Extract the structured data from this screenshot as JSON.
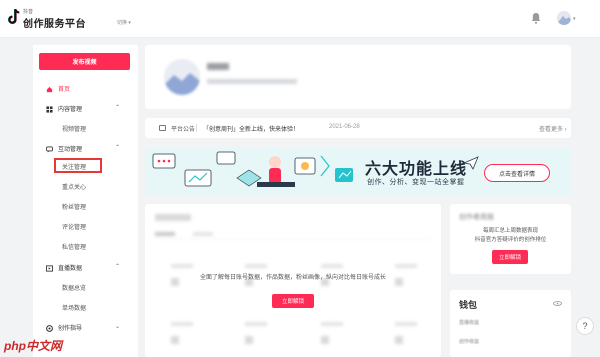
{
  "app": {
    "brand_small": "抖音",
    "brand_title": "创作服务平台",
    "account_switch": "切换"
  },
  "sidebar": {
    "publish_button": "发布视频",
    "home": "首页",
    "content_mgmt": "内容管理",
    "video_mgmt": "视频管理",
    "interaction_mgmt": "互动管理",
    "follow_mgmt": "关注管理",
    "key_followers": "重点关心",
    "fans_mgmt": "粉丝管理",
    "comment_mgmt": "评论管理",
    "dm_mgmt": "私信管理",
    "live_data": "直播数据",
    "data_overview": "数据总览",
    "per_session": "单场数据",
    "creator_guide": "创作指导"
  },
  "notice": {
    "label": "平台公告",
    "text": "「创意周刊」全新上线，快来体验！",
    "date": "2021-06-28",
    "more": "查看更多"
  },
  "banner": {
    "title": "六大功能上线",
    "subtitle": "创作、分析、变现一站全掌握",
    "button": "点击查看详情"
  },
  "data_panel": {
    "message": "全面了解每日账号数据，作品数据，粉丝画像，纵向对比每日账号成长",
    "button": "立即解锁"
  },
  "weekly": {
    "title": "创作者周报",
    "line1": "每周汇总上周数据表现",
    "line2": "抖音官方答疑评价的创作排位",
    "button": "立即解锁"
  },
  "wallet": {
    "title": "钱包",
    "row1": "直播收益",
    "row2": "创作收益"
  },
  "help": {
    "label": "?"
  },
  "watermark": {
    "text": "php中文网"
  },
  "colors": {
    "accent": "#fe2c55",
    "background": "#f2f3f5",
    "banner_bg": "#e7f6f6",
    "highlight_box": "#e53935"
  }
}
